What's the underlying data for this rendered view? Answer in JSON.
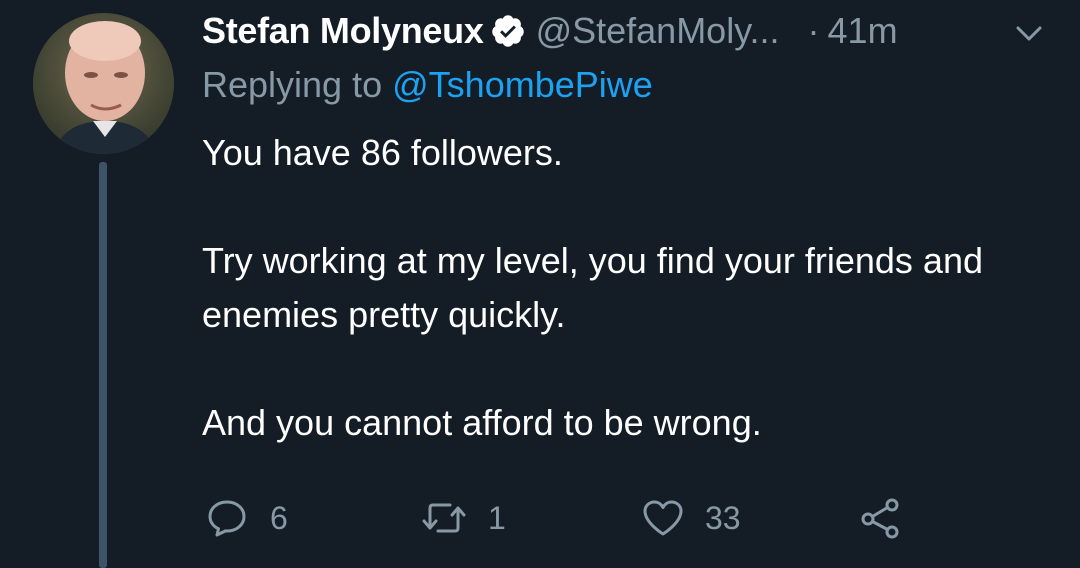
{
  "tweet": {
    "author_name": "Stefan Molyneux",
    "author_handle": "@StefanMoly...",
    "separator": "·",
    "time_ago": "41m",
    "replying_prefix": "Replying to",
    "replying_to": "@TshombePiwe",
    "paragraphs": [
      "You have 86 followers.",
      "Try working at my level, you find your friends and enemies pretty quickly.",
      "And you cannot afford to be wrong."
    ]
  },
  "actions": {
    "reply_count": "6",
    "retweet_count": "1",
    "like_count": "33"
  },
  "icons": {
    "verified": "verified-badge-icon",
    "menu": "chevron-down-icon",
    "reply": "reply-bubble-icon",
    "retweet": "retweet-icon",
    "like": "heart-icon",
    "share": "share-icon"
  },
  "colors": {
    "background": "#141d26",
    "text": "#ffffff",
    "muted": "#8899a6",
    "link": "#1da1f2",
    "thread_line": "#3d5466"
  }
}
